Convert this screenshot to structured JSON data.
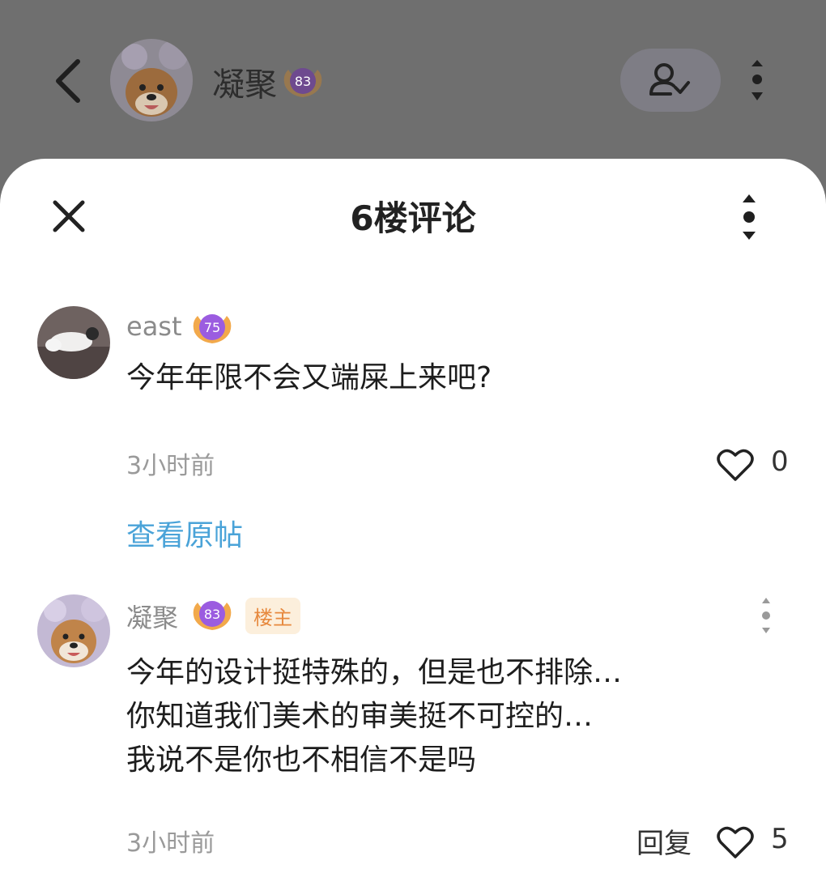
{
  "header": {
    "user_name": "凝聚",
    "level": "83"
  },
  "sheet": {
    "title": "6楼评论"
  },
  "comments": [
    {
      "user": "east",
      "level": "75",
      "text_lines": [
        "今年年限不会又端屎上来吧?"
      ],
      "time": "3小时前",
      "likes": "0",
      "view_post": "查看原帖"
    },
    {
      "user": "凝聚",
      "level": "83",
      "tag": "楼主",
      "text_lines": [
        "今年的设计挺特殊的，但是也不排除…",
        "你知道我们美术的审美挺不可控的…",
        "我说不是你也不相信不是吗"
      ],
      "time": "3小时前",
      "reply": "回复",
      "likes": "5"
    }
  ],
  "colors": {
    "accent_link": "#4aa3d8",
    "owner_tag_bg": "#fcefdc",
    "owner_tag_text": "#e7893e",
    "level_badge": "#9b5ce0"
  },
  "icons": [
    "back-arrow-icon",
    "follow-check-icon",
    "more-vertical-icon",
    "close-icon",
    "heart-icon",
    "level-badge-icon"
  ]
}
